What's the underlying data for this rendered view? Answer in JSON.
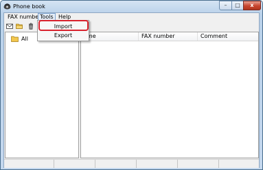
{
  "window": {
    "title": "Phone book"
  },
  "controls": {
    "minimize": "–",
    "maximize": "□",
    "close": "x"
  },
  "menu": {
    "fax_number": "FAX number",
    "tools": "Tools",
    "help": "Help"
  },
  "toolbar": {
    "icons": [
      "envelope-icon",
      "folder-icon",
      "trash-icon"
    ]
  },
  "tree": {
    "root_label": "All"
  },
  "list": {
    "columns": [
      "ame",
      "FAX number",
      "Comment"
    ]
  },
  "dropdown": {
    "items": [
      "Import",
      "Export"
    ]
  },
  "colors": {
    "highlight": "#d9232e",
    "title_gradient_top": "#d5e4f3",
    "close_button": "#c8452e"
  }
}
